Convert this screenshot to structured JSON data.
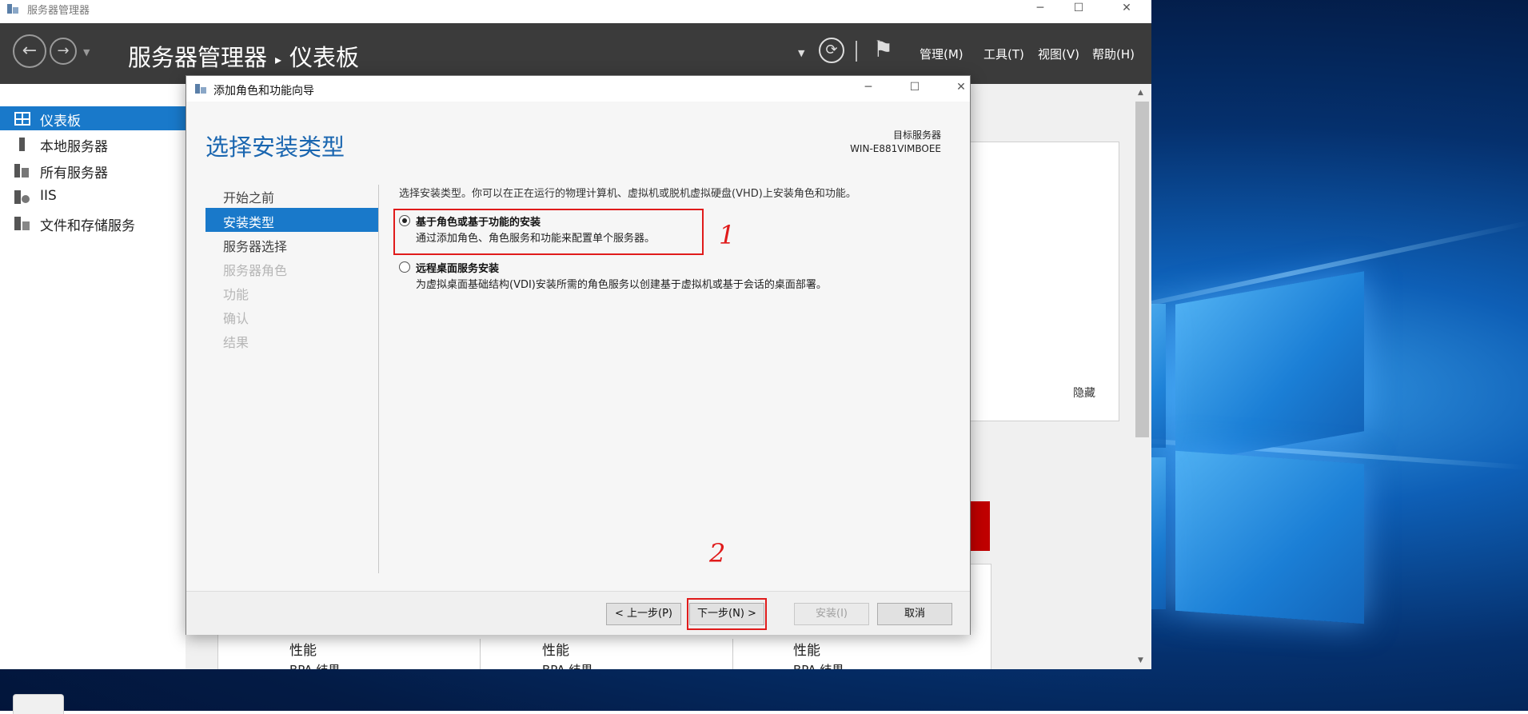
{
  "server_manager": {
    "window_title": "服务器管理器",
    "breadcrumb_app": "服务器管理器",
    "breadcrumb_page": "仪表板",
    "breadcrumb_separator": "▸",
    "menu": [
      "管理(M)",
      "工具(T)",
      "视图(V)",
      "帮助(H)"
    ],
    "sidebar": [
      {
        "label": "仪表板",
        "icon": "dashboard-icon",
        "active": true
      },
      {
        "label": "本地服务器",
        "icon": "server-icon",
        "active": false
      },
      {
        "label": "所有服务器",
        "icon": "servers-icon",
        "active": false
      },
      {
        "label": "IIS",
        "icon": "iis-icon",
        "active": false
      },
      {
        "label": "文件和存储服务",
        "icon": "storage-icon",
        "active": false
      }
    ],
    "hide_label": "隐藏",
    "tiles": [
      "性能",
      "性能",
      "性能"
    ],
    "tiles_sub": [
      "BPA 结果",
      "BPA 结果",
      "BPA 结果"
    ]
  },
  "dialog": {
    "title": "添加角色和功能向导",
    "heading": "选择安装类型",
    "target_label": "目标服务器",
    "target_server": "WIN-E881VIMBOEE",
    "steps": [
      {
        "label": "开始之前",
        "state": "normal"
      },
      {
        "label": "安装类型",
        "state": "active"
      },
      {
        "label": "服务器选择",
        "state": "normal"
      },
      {
        "label": "服务器角色",
        "state": "disabled"
      },
      {
        "label": "功能",
        "state": "disabled"
      },
      {
        "label": "确认",
        "state": "disabled"
      },
      {
        "label": "结果",
        "state": "disabled"
      }
    ],
    "description": "选择安装类型。你可以在正在运行的物理计算机、虚拟机或脱机虚拟硬盘(VHD)上安装角色和功能。",
    "options": [
      {
        "label": "基于角色或基于功能的安装",
        "description": "通过添加角色、角色服务和功能来配置单个服务器。",
        "selected": true
      },
      {
        "label": "远程桌面服务安装",
        "description": "为虚拟桌面基础结构(VDI)安装所需的角色服务以创建基于虚拟机或基于会话的桌面部署。",
        "selected": false
      }
    ],
    "buttons": {
      "prev": "< 上一步(P)",
      "next": "下一步(N) >",
      "install": "安装(I)",
      "cancel": "取消"
    }
  },
  "annotations": {
    "first": "1",
    "second": "2",
    "color": "#e01b1b"
  },
  "colors": {
    "accent": "#1979ca",
    "header": "#3b3b3b",
    "heading": "#1a66b0"
  }
}
